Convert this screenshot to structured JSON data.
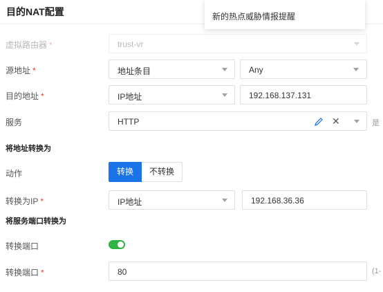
{
  "title": "目的NAT配置",
  "notification": {
    "text": "新的热点威胁情报提醒"
  },
  "form": {
    "virtual_router": {
      "label": "虚拟路由器",
      "value": "trust-vr"
    },
    "source_address": {
      "label": "源地址",
      "type_value": "地址条目",
      "value": "Any"
    },
    "destination_address": {
      "label": "目的地址",
      "type_value": "IP地址",
      "value": "192.168.137.131"
    },
    "service": {
      "label": "服务",
      "value": "HTTP",
      "side_text": "是"
    },
    "translate_address_section": "将地址转换为",
    "action": {
      "label": "动作",
      "options": [
        "转换",
        "不转换"
      ],
      "selected": "转换"
    },
    "translate_ip": {
      "label": "转换为IP",
      "type_value": "IP地址",
      "value": "192.168.36.36"
    },
    "translate_port_section": "将服务端口转换为",
    "port_toggle": {
      "label": "转换端口",
      "enabled": true
    },
    "translate_port": {
      "label": "转换端口",
      "value": "80",
      "side_text": "(1-"
    }
  },
  "required_mark": "*",
  "colors": {
    "primary": "#1a73e8",
    "toggle_on": "#2fb344",
    "required": "#e53935"
  }
}
